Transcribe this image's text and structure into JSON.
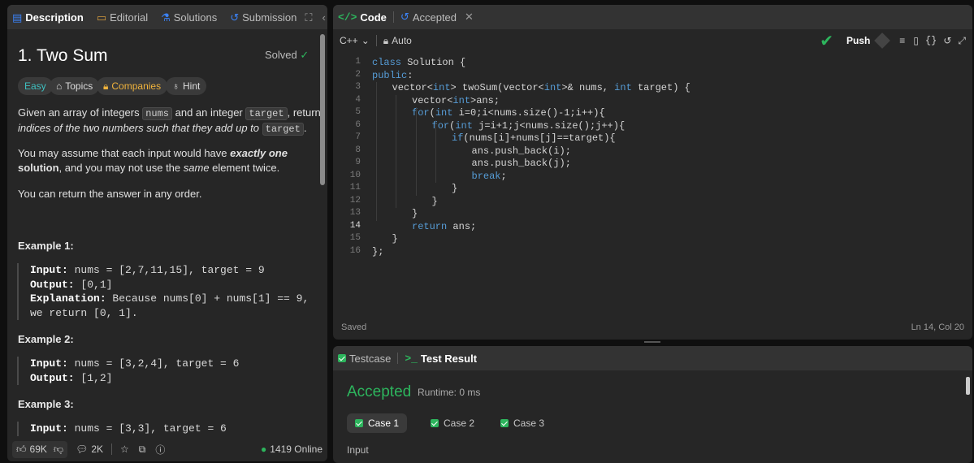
{
  "left_tabs": {
    "description": "Description",
    "editorial": "Editorial",
    "solutions": "Solutions",
    "submission": "Submission"
  },
  "problem": {
    "title": "1. Two Sum",
    "status": "Solved",
    "tags": {
      "difficulty": "Easy",
      "topics": "Topics",
      "companies": "Companies",
      "hint": "Hint"
    },
    "p1a": "Given an array of integers ",
    "p1b": "nums",
    "p1c": " and an integer ",
    "p1d": "target",
    "p1e": ", return",
    "p1f": "indices of the two numbers such that they add up to ",
    "p1g": "target",
    "p1h": ".",
    "p2a": "You may assume that each input would have ",
    "p2b": "exactly one",
    "p2c": "solution",
    "p2d": ", and you may not use the ",
    "p2e": "same",
    "p2f": " element twice.",
    "p3": "You can return the answer in any order.",
    "examples": [
      {
        "title": "Example 1:",
        "input_label": "Input:",
        "input": " nums = [2,7,11,15], target = 9",
        "output_label": "Output:",
        "output": " [0,1]",
        "expl_label": "Explanation:",
        "expl1": " Because nums[0] + nums[1] == 9,",
        "expl2": "we return [0, 1]."
      },
      {
        "title": "Example 2:",
        "input_label": "Input:",
        "input": " nums = [3,2,4], target = 6",
        "output_label": "Output:",
        "output": " [1,2]"
      },
      {
        "title": "Example 3:",
        "input_label": "Input:",
        "input": " nums = [3,3], target = 6"
      }
    ]
  },
  "footer": {
    "likes": "69K",
    "comments": "2K",
    "online": "1419 Online"
  },
  "code_tabs": {
    "code": "Code",
    "accepted": "Accepted"
  },
  "editor": {
    "language": "C++",
    "mode": "Auto",
    "push": "Push",
    "saved": "Saved",
    "cursor": "Ln 14, Col 20",
    "lines": [
      {
        "n": "1",
        "t": "class Solution {",
        "i": 0
      },
      {
        "n": "2",
        "t": "public:",
        "i": 0
      },
      {
        "n": "3",
        "t": "vector<int> twoSum(vector<int>& nums, int target) {",
        "i": 1
      },
      {
        "n": "4",
        "t": "vector<int>ans;",
        "i": 2
      },
      {
        "n": "5",
        "t": "for(int i=0;i<nums.size()-1;i++){",
        "i": 2
      },
      {
        "n": "6",
        "t": "for(int j=i+1;j<nums.size();j++){",
        "i": 3
      },
      {
        "n": "7",
        "t": "if(nums[i]+nums[j]==target){",
        "i": 4
      },
      {
        "n": "8",
        "t": "ans.push_back(i);",
        "i": 5
      },
      {
        "n": "9",
        "t": "ans.push_back(j);",
        "i": 5
      },
      {
        "n": "10",
        "t": "break;",
        "i": 5
      },
      {
        "n": "11",
        "t": "}",
        "i": 4
      },
      {
        "n": "12",
        "t": "}",
        "i": 3
      },
      {
        "n": "13",
        "t": "}",
        "i": 2
      },
      {
        "n": "14",
        "t": "return ans;",
        "i": 2
      },
      {
        "n": "15",
        "t": "}",
        "i": 1
      },
      {
        "n": "16",
        "t": "};",
        "i": 0
      }
    ]
  },
  "result": {
    "testcase_tab": "Testcase",
    "result_tab": "Test Result",
    "verdict": "Accepted",
    "runtime": "Runtime: 0 ms",
    "cases": [
      "Case 1",
      "Case 2",
      "Case 3"
    ],
    "input_label": "Input"
  },
  "colors": {
    "accent_green": "#2db55d",
    "link_blue": "#3b82f6",
    "keyword": "#569cd6"
  }
}
